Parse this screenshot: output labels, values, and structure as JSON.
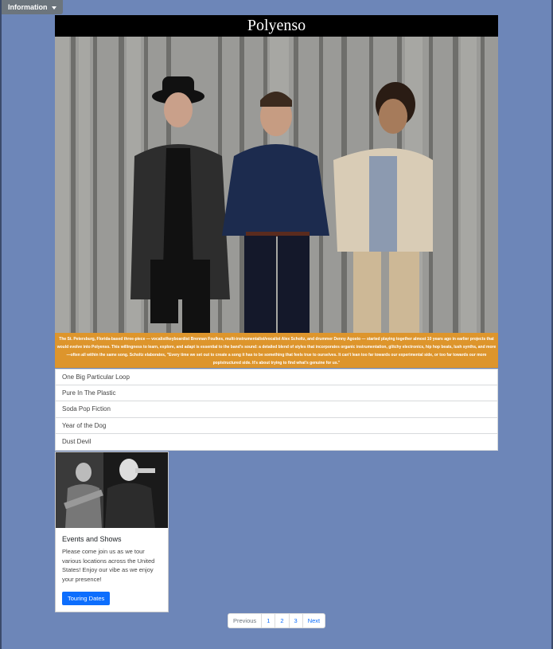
{
  "nav": {
    "dropdown_label": "Information"
  },
  "band": {
    "name": "Polyenso",
    "bio": "The St. Petersburg, Florida-based three-piece — vocalist/keyboardist Brennan Foulkes, multi-instrumentalist/vocalist Alex Scholtz, and drummer Denny Agosto — started playing together almost 10 years ago in earlier projects that would evolve into Polyenso. This willingness to learn, explore, and adapt is essential to the band's sound: a detailed blend of styles that incorporates organic instrumentation, glitchy electronics, hip hop beats, lush synths, and more—often all within the same song. Scholtz elaborates, \"Every time we set out to create a song it has to be something that feels true to ourselves. It can't lean too far towards our experimental side, or too far towards our more pop/structured side. It's about trying to find what's genuine for us.\""
  },
  "songs": [
    {
      "title": "One Big Particular Loop"
    },
    {
      "title": "Pure In The Plastic"
    },
    {
      "title": "Soda Pop Fiction"
    },
    {
      "title": "Year of the Dog"
    },
    {
      "title": "Dust Devil"
    }
  ],
  "events_card": {
    "title": "Events and Shows",
    "text": "Please come join us as we tour various locations across the United States! Enjoy our vibe as we enjoy your presence!",
    "button": "Touring Dates"
  },
  "pagination": {
    "previous": "Previous",
    "pages": [
      "1",
      "2",
      "3"
    ],
    "next": "Next"
  }
}
